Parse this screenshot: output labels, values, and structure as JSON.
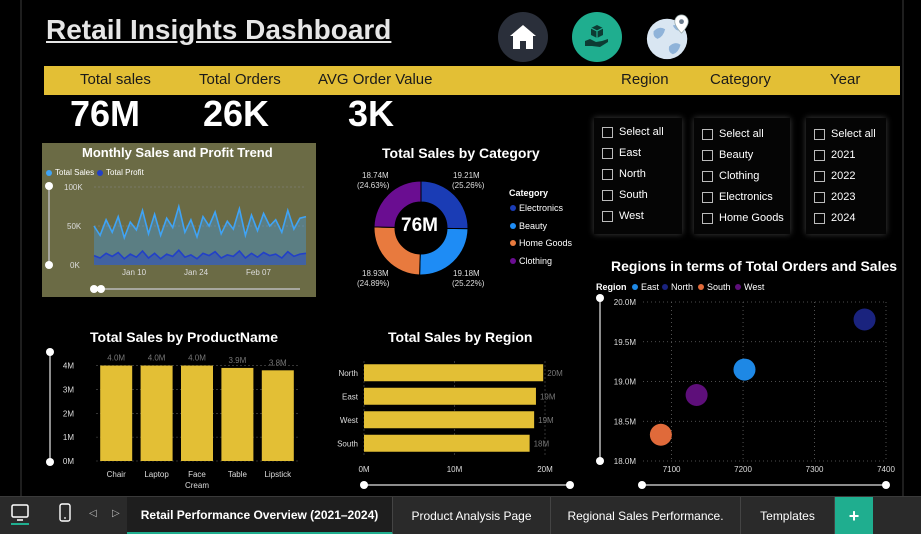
{
  "header": {
    "title": "Retail Insights Dashboard"
  },
  "nav_icons": [
    "home-icon",
    "box-in-hand-icon",
    "globe-location-icon"
  ],
  "banner": {
    "total_sales": "Total sales",
    "total_orders": "Total Orders",
    "avg_order_value": "AVG Order Value",
    "region": "Region",
    "category": "Category",
    "year": "Year"
  },
  "kpis": {
    "total_sales": "76M",
    "total_orders": "26K",
    "avg_order_value": "3K"
  },
  "slicers": {
    "region": [
      "Select all",
      "East",
      "North",
      "South",
      "West"
    ],
    "category": [
      "Select all",
      "Beauty",
      "Clothing",
      "Electronics",
      "Home Goods"
    ],
    "year": [
      "Select all",
      "2021",
      "2022",
      "2023",
      "2024"
    ]
  },
  "monthly_trend": {
    "title": "Monthly Sales and Profit Trend",
    "legend": [
      "Total Sales",
      "Total Profit"
    ],
    "yticks": [
      "100K",
      "50K",
      "0K"
    ],
    "xticks": [
      "Jan 10",
      "Jan 24",
      "Feb 07"
    ]
  },
  "category_donut": {
    "title": "Total Sales by Category",
    "center": "76M",
    "legend_title": "Category",
    "labels": [
      {
        "value": "19.21M",
        "pct": "(25.26%)"
      },
      {
        "value": "19.18M",
        "pct": "(25.22%)"
      },
      {
        "value": "18.93M",
        "pct": "(24.89%)"
      },
      {
        "value": "18.74M",
        "pct": "(24.63%)"
      }
    ]
  },
  "product_chart": {
    "title": "Total Sales by ProductName"
  },
  "region_chart": {
    "title": "Total Sales by Region"
  },
  "scatter_chart": {
    "title": "Regions in terms of Total Orders and Sales",
    "legend_title": "Region"
  },
  "tabs": [
    "Retail Performance Overview (2021–2024)",
    "Product Analysis Page",
    "Regional Sales Performance.",
    "Templates",
    "+"
  ],
  "colors": {
    "accent": "#e3bf35",
    "east": "#1e88e5",
    "north": "#1a237e",
    "south": "#e06a3a",
    "west": "#5e0f7a",
    "electronics": "#1a3cb5",
    "beauty": "#1e8cf5",
    "homegoods": "#e87a3e",
    "clothing": "#6a0d91"
  },
  "chart_data": [
    {
      "type": "line",
      "title": "Monthly Sales and Profit Trend",
      "x": [
        "Jan 10",
        "Jan 24",
        "Feb 07"
      ],
      "ylim": [
        0,
        100000
      ],
      "series": [
        {
          "name": "Total Sales",
          "values": [
            50000,
            38000,
            58000,
            42000,
            62000,
            35000,
            55000,
            45000,
            70000,
            40000,
            65000,
            38000,
            60000,
            48000,
            75000,
            42000,
            58000,
            36000,
            62000,
            50000,
            68000,
            40000,
            56000,
            46000,
            72000,
            38000,
            64000,
            44000,
            66000,
            50000,
            58000,
            42000,
            70000,
            46000,
            60000,
            62000
          ]
        },
        {
          "name": "Total Profit",
          "values": [
            12000,
            9000,
            15000,
            11000,
            16000,
            8000,
            14000,
            10000,
            18000,
            9000,
            15000,
            8000,
            14000,
            11000,
            19000,
            10000,
            13000,
            8000,
            15000,
            12000,
            17000,
            9000,
            13000,
            11000,
            18000,
            9000,
            15000,
            10000,
            16000,
            12000,
            14000,
            9000,
            17000,
            11000,
            14000,
            15000
          ]
        }
      ],
      "legend": "top-left"
    },
    {
      "type": "pie",
      "title": "Total Sales by Category",
      "categories": [
        "Electronics",
        "Beauty",
        "Home Goods",
        "Clothing"
      ],
      "values": [
        19.21,
        19.18,
        18.93,
        18.74
      ],
      "percent": [
        25.26,
        25.22,
        24.89,
        24.63
      ]
    },
    {
      "type": "bar",
      "title": "Total Sales by ProductName",
      "categories": [
        "Chair",
        "Laptop",
        "Face Cream",
        "Table",
        "Lipstick"
      ],
      "values": [
        4.0,
        4.0,
        4.0,
        3.9,
        3.8
      ],
      "labels": [
        "4.0M",
        "4.0M",
        "4.0M",
        "3.9M",
        "3.8M"
      ],
      "yticks": [
        "4M",
        "3M",
        "2M",
        "1M",
        "0M"
      ],
      "ylim": [
        0,
        4.4
      ]
    },
    {
      "type": "bar",
      "orientation": "horizontal",
      "title": "Total Sales by Region",
      "categories": [
        "North",
        "East",
        "West",
        "South"
      ],
      "values": [
        19.8,
        19.0,
        18.8,
        18.3
      ],
      "labels": [
        "20M",
        "19M",
        "19M",
        "18M"
      ],
      "xticks": [
        "0M",
        "10M",
        "20M"
      ],
      "xlim": [
        0,
        20
      ]
    },
    {
      "type": "scatter",
      "title": "Regions in terms of Total Orders and Sales",
      "series": [
        {
          "name": "East",
          "x": 7202,
          "y": 19.15
        },
        {
          "name": "North",
          "x": 7370,
          "y": 19.78
        },
        {
          "name": "South",
          "x": 7085,
          "y": 18.33
        },
        {
          "name": "West",
          "x": 7135,
          "y": 18.83
        }
      ],
      "xticks": [
        "7100",
        "7200",
        "7300",
        "7400"
      ],
      "yticks": [
        "20.0M",
        "19.5M",
        "19.0M",
        "18.5M",
        "18.0M"
      ],
      "xlim": [
        7060,
        7400
      ],
      "ylim": [
        18.0,
        20.0
      ],
      "legend": "top-left"
    }
  ]
}
